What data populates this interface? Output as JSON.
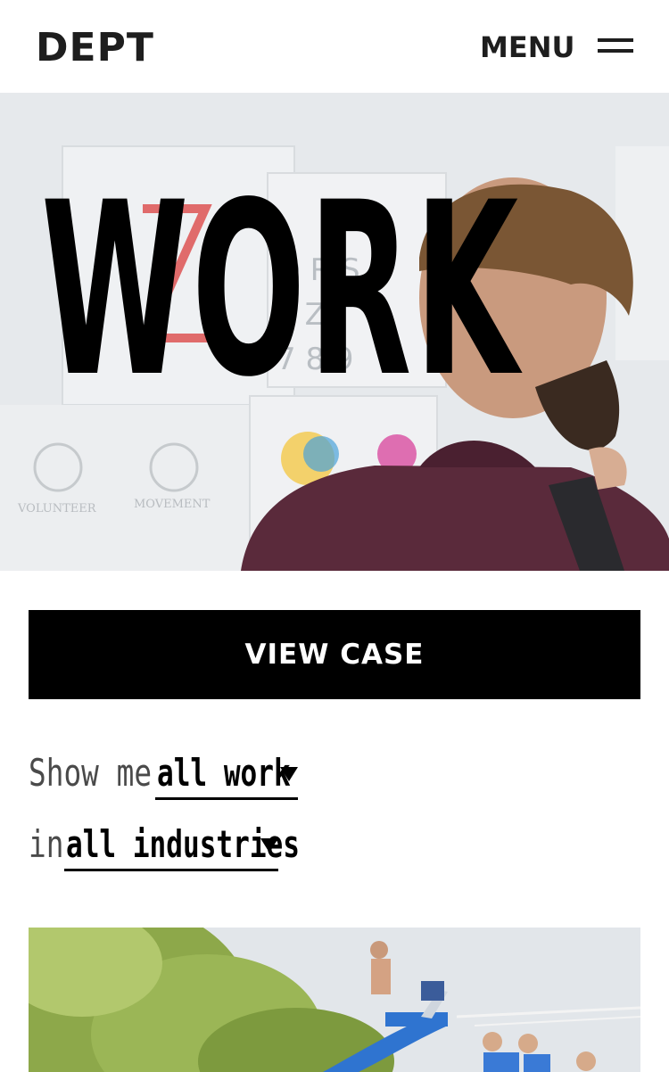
{
  "header": {
    "logo": "DEPT",
    "menu_label": "MENU",
    "menu_icon": "hamburger-icon"
  },
  "hero": {
    "title": "WORK",
    "image_description_icon": "photo"
  },
  "cta": {
    "view_case_label": "VIEW CASE"
  },
  "filters": {
    "row1": {
      "label": "Show me",
      "value": "all work"
    },
    "row2": {
      "label": "in",
      "value": "all industries"
    },
    "caret_icon": "caret-down-icon"
  },
  "colors": {
    "text": "#1e1e1e",
    "button_bg": "#000000",
    "button_text": "#ffffff",
    "label_gray": "#4a4a4a",
    "shirt": "#5a2a3b",
    "slide_blue": "#2f74d0"
  }
}
